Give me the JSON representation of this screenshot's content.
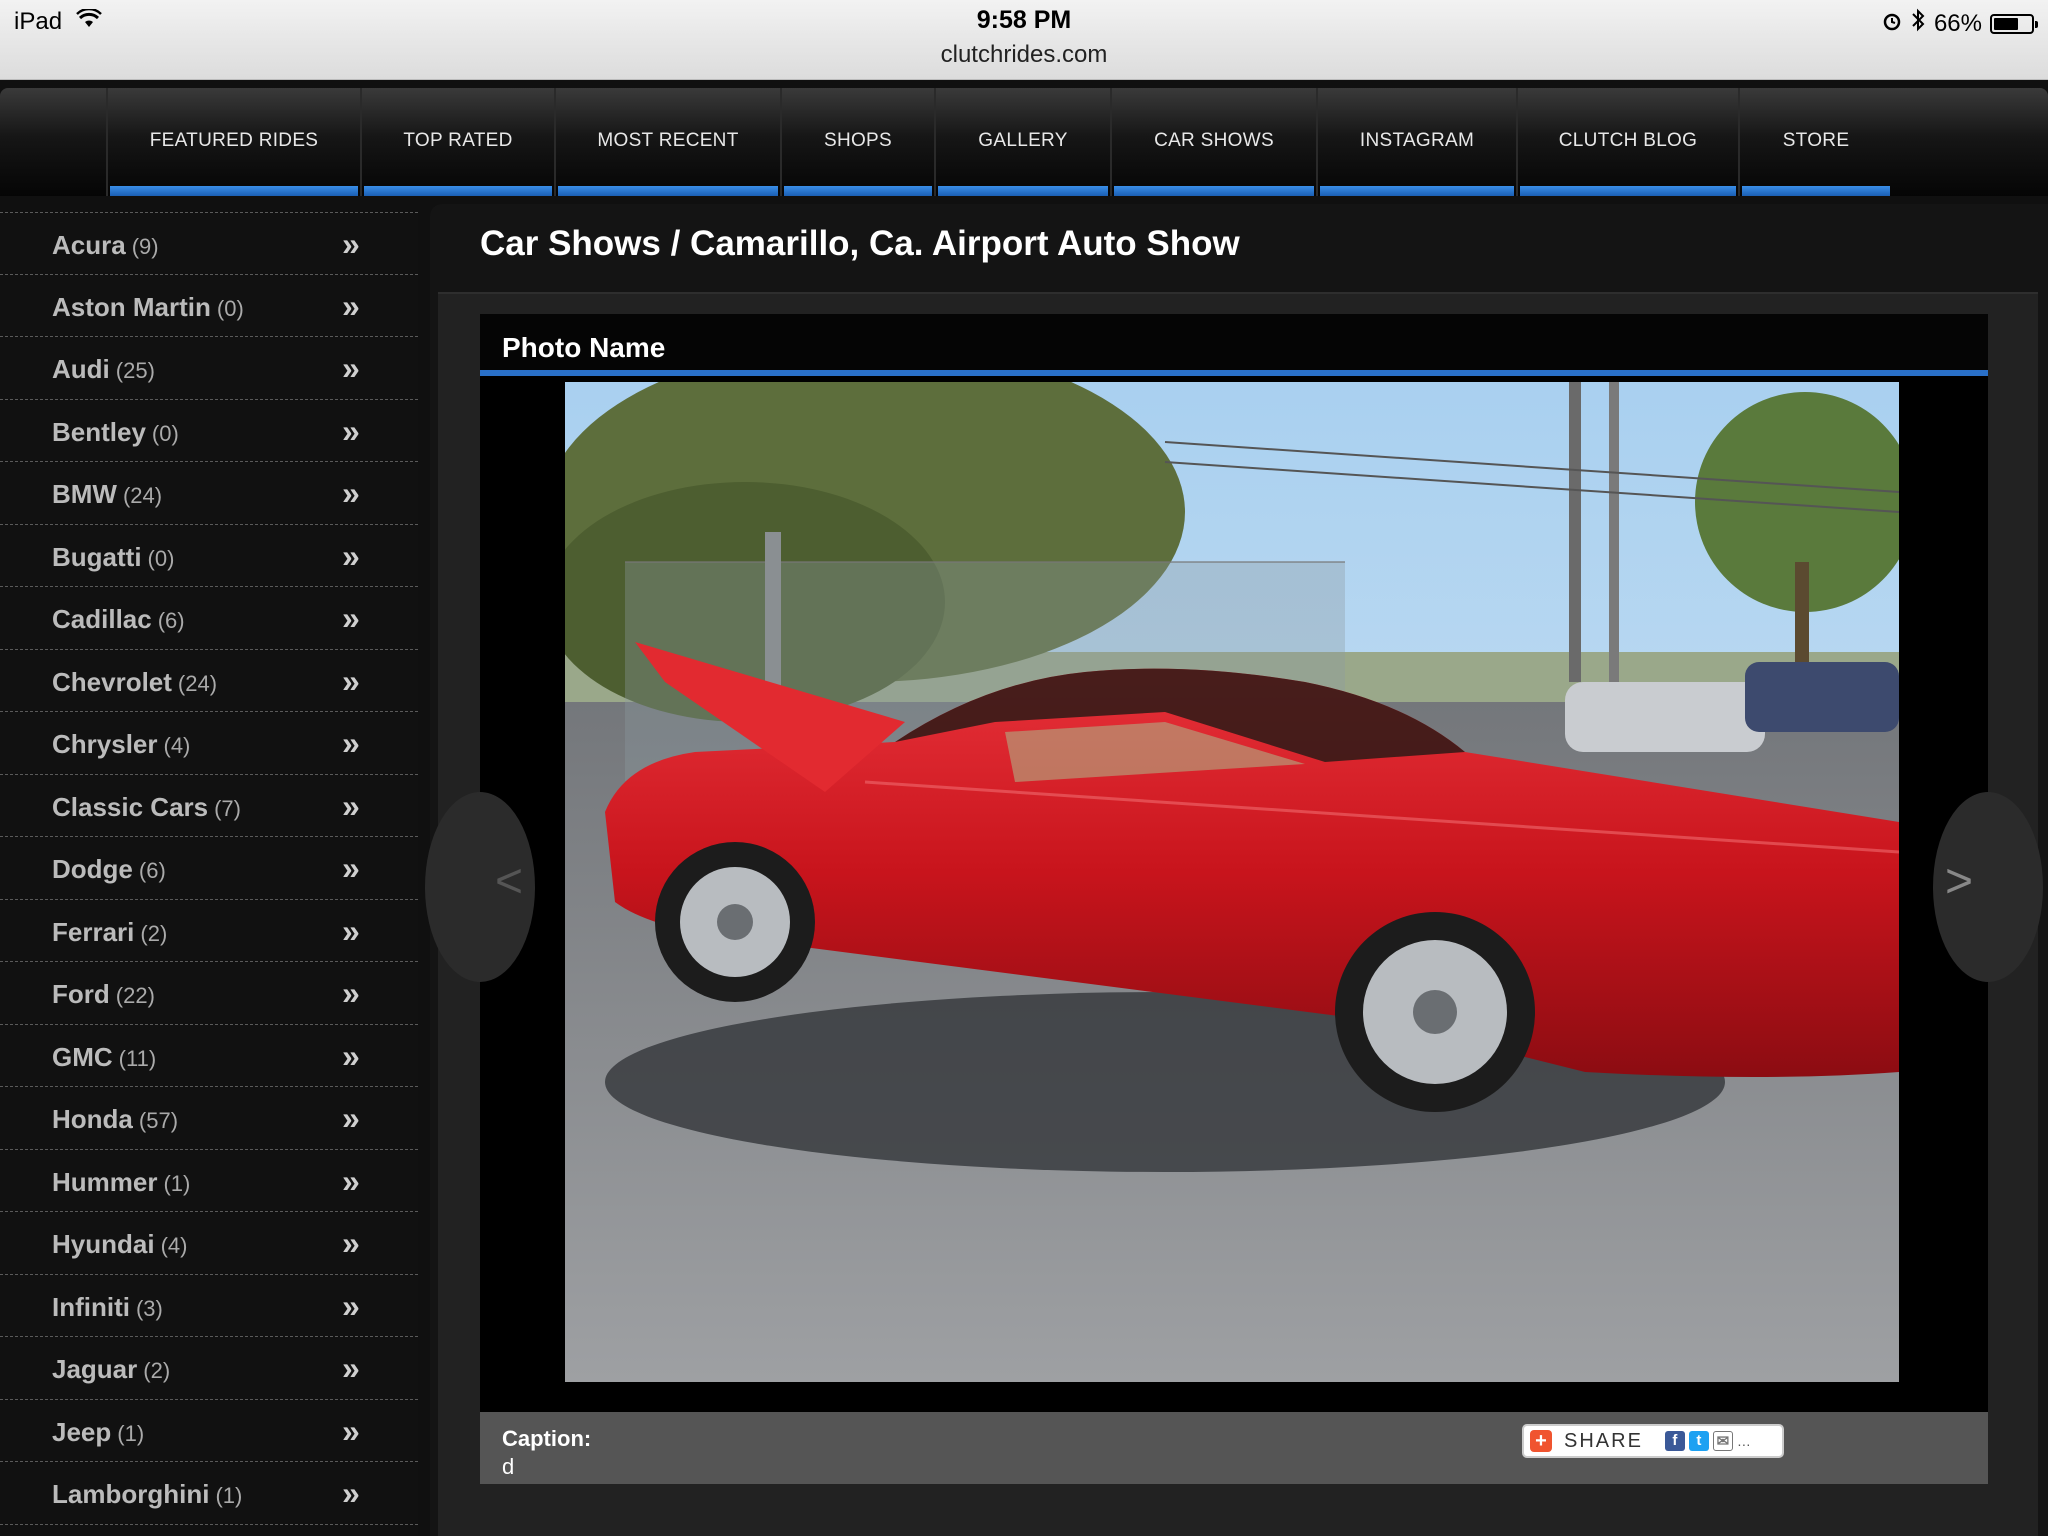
{
  "status_bar": {
    "device": "iPad",
    "time": "9:58 PM",
    "url": "clutchrides.com",
    "battery": "66%",
    "battery_level": 0.66
  },
  "nav": [
    {
      "label": "FEATURED RIDES"
    },
    {
      "label": "TOP RATED"
    },
    {
      "label": "MOST RECENT"
    },
    {
      "label": "SHOPS"
    },
    {
      "label": "GALLERY"
    },
    {
      "label": "CAR SHOWS"
    },
    {
      "label": "INSTAGRAM"
    },
    {
      "label": "CLUTCH BLOG"
    },
    {
      "label": "STORE"
    }
  ],
  "sidebar": {
    "chevron": "»",
    "items": [
      {
        "name": "Acura",
        "count": "(9)"
      },
      {
        "name": "Aston Martin",
        "count": "(0)"
      },
      {
        "name": "Audi",
        "count": "(25)"
      },
      {
        "name": "Bentley",
        "count": "(0)"
      },
      {
        "name": "BMW",
        "count": "(24)"
      },
      {
        "name": "Bugatti",
        "count": "(0)"
      },
      {
        "name": "Cadillac",
        "count": "(6)"
      },
      {
        "name": "Chevrolet",
        "count": "(24)"
      },
      {
        "name": "Chrysler",
        "count": "(4)"
      },
      {
        "name": "Classic Cars",
        "count": "(7)"
      },
      {
        "name": "Dodge",
        "count": "(6)"
      },
      {
        "name": "Ferrari",
        "count": "(2)"
      },
      {
        "name": "Ford",
        "count": "(22)"
      },
      {
        "name": "GMC",
        "count": "(11)"
      },
      {
        "name": "Honda",
        "count": "(57)"
      },
      {
        "name": "Hummer",
        "count": "(1)"
      },
      {
        "name": "Hyundai",
        "count": "(4)"
      },
      {
        "name": "Infiniti",
        "count": "(3)"
      },
      {
        "name": "Jaguar",
        "count": "(2)"
      },
      {
        "name": "Jeep",
        "count": "(1)"
      },
      {
        "name": "Lamborghini",
        "count": "(1)"
      }
    ]
  },
  "main": {
    "title": "Car Shows / Camarillo, Ca. Airport Auto Show",
    "photo_header": "Photo Name",
    "caption_label": "Caption:",
    "caption_text": "d",
    "share_label": "SHARE",
    "prev_arrow": "<",
    "next_arrow": ">"
  },
  "colors": {
    "accent_blue": "#2a70c8",
    "car_red": "#c8141c"
  }
}
